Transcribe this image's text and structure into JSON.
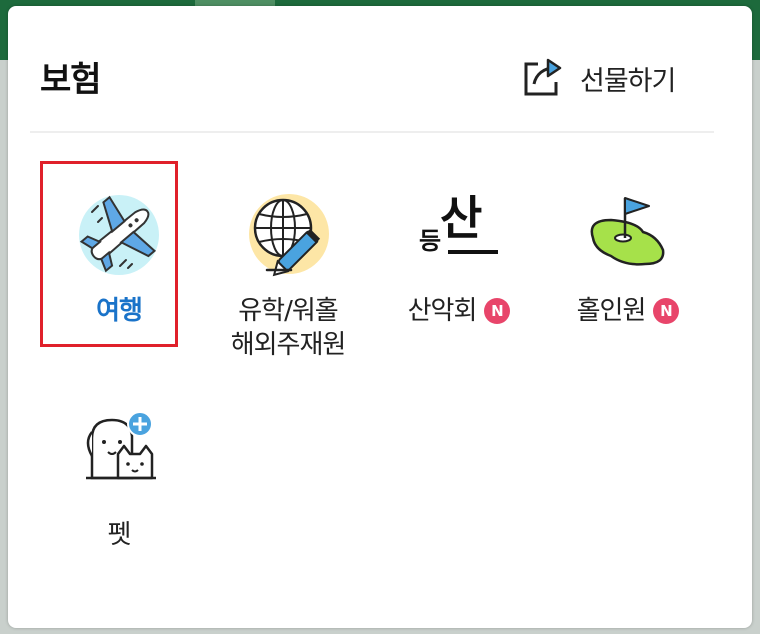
{
  "header": {
    "title": "보험",
    "gift_label": "선물하기"
  },
  "menu": {
    "items": [
      {
        "label": "여행",
        "icon": "airplane-icon",
        "selected": true
      },
      {
        "label_line1": "유학/워홀",
        "label_line2": "해외주재원",
        "icon": "globe-pen-icon"
      },
      {
        "label": "산악회",
        "badge": "N",
        "icon": "mountain-club-icon",
        "icon_text_main": "산",
        "icon_text_sub": "등"
      },
      {
        "label": "홀인원",
        "badge": "N",
        "icon": "golf-flag-icon"
      },
      {
        "label": "펫",
        "icon": "pet-plus-icon"
      }
    ]
  },
  "colors": {
    "selected_text": "#1a73c9",
    "highlight_border": "#e0202a",
    "new_badge": "#e8456a",
    "top_bar": "#1d6a3c"
  }
}
